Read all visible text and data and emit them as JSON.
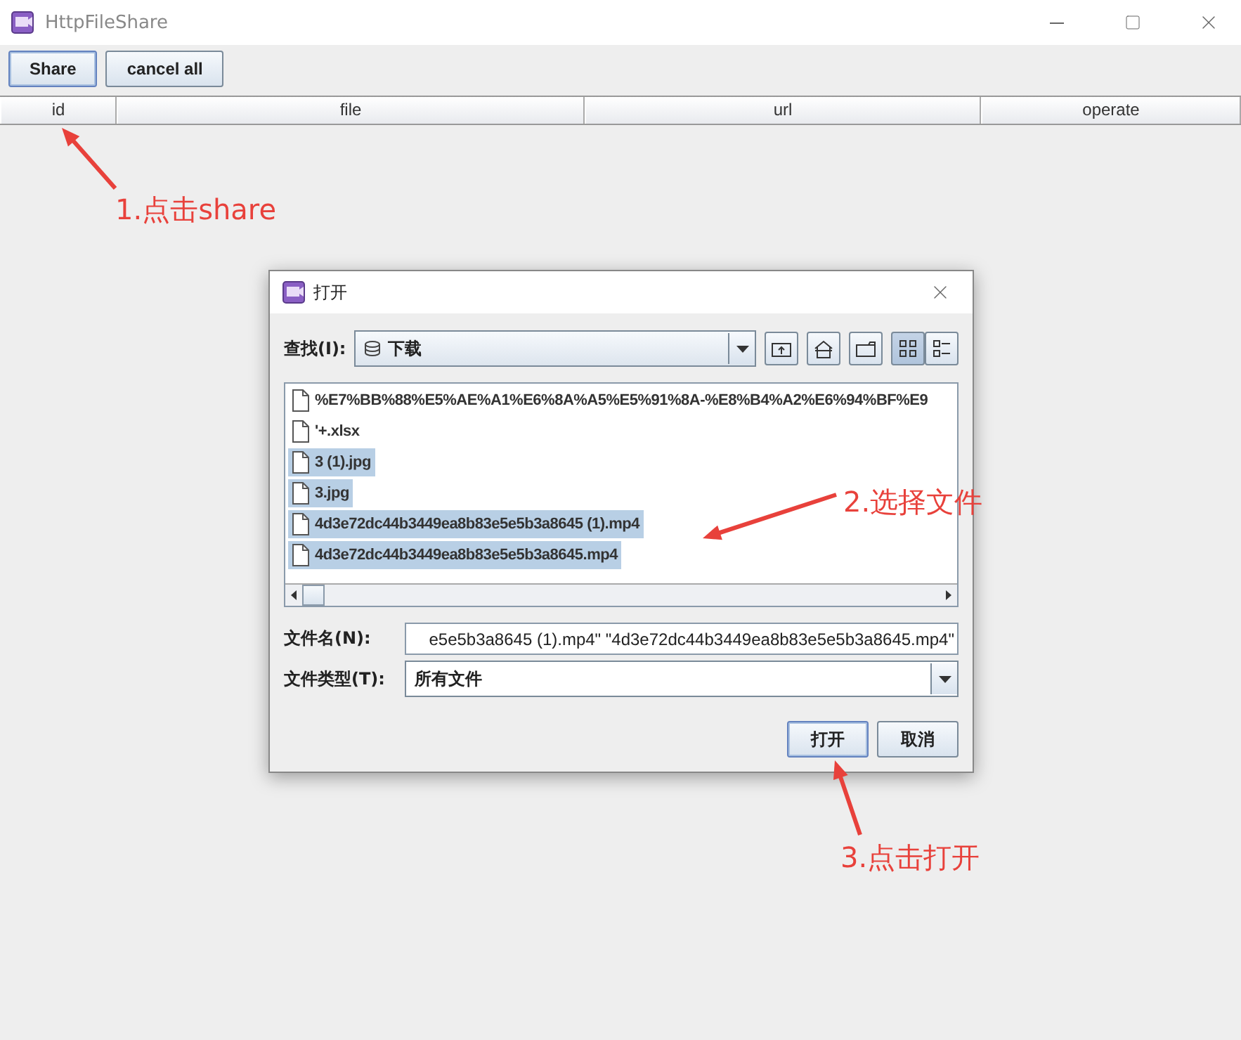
{
  "window": {
    "title": "HttpFileShare"
  },
  "toolbar": {
    "buttons": [
      {
        "label": "Share",
        "focused": true
      },
      {
        "label": "cancel all",
        "focused": false
      }
    ]
  },
  "table": {
    "columns": [
      "id",
      "file",
      "url",
      "operate"
    ]
  },
  "dialog": {
    "title": "打开",
    "look_in": {
      "label": "查找(I):",
      "value": "下载"
    },
    "view_modes": [
      {
        "kind": "list",
        "selected": true
      },
      {
        "kind": "details",
        "selected": false
      }
    ],
    "files": [
      {
        "name": "%E7%BB%88%E5%AE%A1%E6%8A%A5%E5%91%8A-%E8%B4%A2%E6%94%BF%E9",
        "selected": false
      },
      {
        "name": "'+.xlsx",
        "selected": false
      },
      {
        "name": "3 (1).jpg",
        "selected": true
      },
      {
        "name": "3.jpg",
        "selected": true
      },
      {
        "name": "4d3e72dc44b3449ea8b83e5e5b3a8645 (1).mp4",
        "selected": true
      },
      {
        "name": "4d3e72dc44b3449ea8b83e5e5b3a8645.mp4",
        "selected": true
      }
    ],
    "file_name": {
      "label": "文件名(N):",
      "value": "e5e5b3a8645 (1).mp4\" \"4d3e72dc44b3449ea8b83e5e5b3a8645.mp4\""
    },
    "file_type": {
      "label": "文件类型(T):",
      "value": "所有文件"
    },
    "buttons": [
      {
        "label": "打开",
        "focused": true
      },
      {
        "label": "取消",
        "focused": false
      }
    ]
  },
  "annotations": [
    {
      "text": "1.点击share"
    },
    {
      "text": "2.选择文件"
    },
    {
      "text": "3.点击打开"
    }
  ]
}
